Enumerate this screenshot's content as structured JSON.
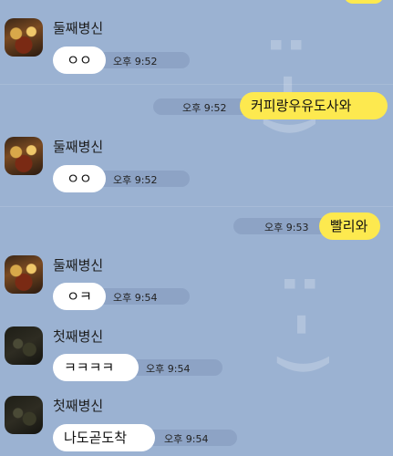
{
  "messages": [
    {
      "sender": "둘째병신",
      "text": "ㅇㅇ",
      "time": "오후 9:52"
    },
    {
      "sender": "me",
      "text": "커피랑우유도사와",
      "time": "오후 9:52"
    },
    {
      "sender": "둘째병신",
      "text": "ㅇㅇ",
      "time": "오후 9:52"
    },
    {
      "sender": "me",
      "text": "빨리와",
      "time": "오후 9:53"
    },
    {
      "sender": "둘째병신",
      "text": "ㅇㅋ",
      "time": "오후 9:54"
    },
    {
      "sender": "첫째병신",
      "text": "ㅋㅋㅋㅋ",
      "time": "오후 9:54"
    },
    {
      "sender": "첫째병신",
      "text": "나도곧도착",
      "time": "오후 9:54"
    }
  ],
  "colors": {
    "background": "#9bb2d2",
    "incoming_bubble": "#ffffff",
    "outgoing_bubble": "#fde94f"
  }
}
